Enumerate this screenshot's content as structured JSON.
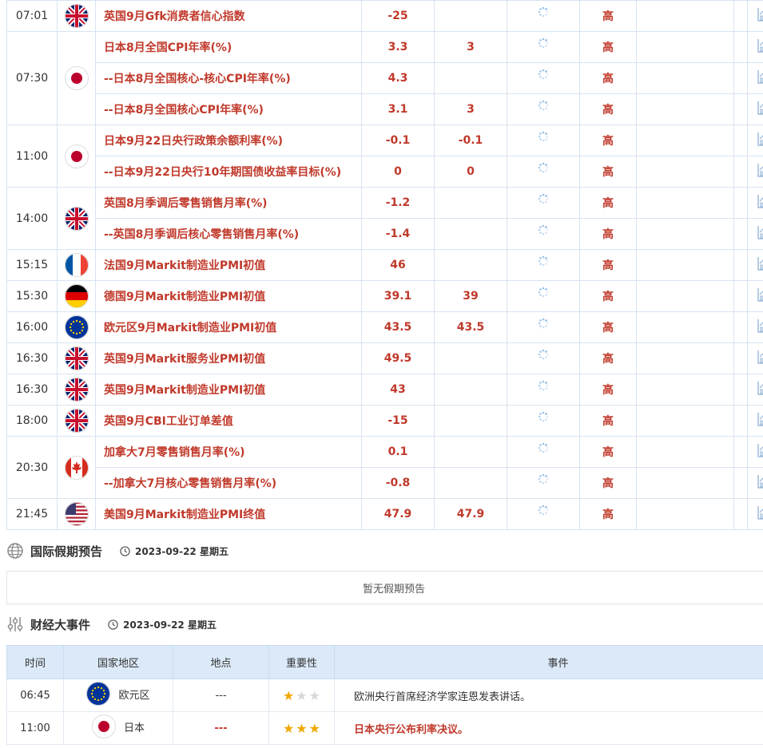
{
  "data_table": {
    "groups": [
      {
        "time": "07:01",
        "flag": "uk-flag-icon",
        "rows": [
          {
            "indicator": "英国9月Gfk消费者信心指数",
            "previous": "-25",
            "forecast": "",
            "importance": "高"
          }
        ]
      },
      {
        "time": "07:30",
        "flag": "japan-flag-icon",
        "rows": [
          {
            "indicator": "日本8月全国CPI年率(%)",
            "previous": "3.3",
            "forecast": "3",
            "importance": "高"
          },
          {
            "indicator": "--日本8月全国核心-核心CPI年率(%)",
            "previous": "4.3",
            "forecast": "",
            "importance": "高"
          },
          {
            "indicator": "--日本8月全国核心CPI年率(%)",
            "previous": "3.1",
            "forecast": "3",
            "importance": "高"
          }
        ]
      },
      {
        "time": "11:00",
        "flag": "japan-flag-icon",
        "rows": [
          {
            "indicator": "日本9月22日央行政策余额利率(%)",
            "previous": "-0.1",
            "forecast": "-0.1",
            "importance": "高"
          },
          {
            "indicator": "--日本9月22日央行10年期国债收益率目标(%)",
            "previous": "0",
            "forecast": "0",
            "importance": "高"
          }
        ]
      },
      {
        "time": "14:00",
        "flag": "uk-flag-icon",
        "rows": [
          {
            "indicator": "英国8月季调后零售销售月率(%)",
            "previous": "-1.2",
            "forecast": "",
            "importance": "高"
          },
          {
            "indicator": "--英国8月季调后核心零售销售月率(%)",
            "previous": "-1.4",
            "forecast": "",
            "importance": "高"
          }
        ]
      },
      {
        "time": "15:15",
        "flag": "france-flag-icon",
        "rows": [
          {
            "indicator": "法国9月Markit制造业PMI初值",
            "previous": "46",
            "forecast": "",
            "importance": "高"
          }
        ]
      },
      {
        "time": "15:30",
        "flag": "germany-flag-icon",
        "rows": [
          {
            "indicator": "德国9月Markit制造业PMI初值",
            "previous": "39.1",
            "forecast": "39",
            "importance": "高"
          }
        ]
      },
      {
        "time": "16:00",
        "flag": "eu-flag-icon",
        "rows": [
          {
            "indicator": "欧元区9月Markit制造业PMI初值",
            "previous": "43.5",
            "forecast": "43.5",
            "importance": "高"
          }
        ]
      },
      {
        "time": "16:30",
        "flag": "uk-flag-icon",
        "rows": [
          {
            "indicator": "英国9月Markit服务业PMI初值",
            "previous": "49.5",
            "forecast": "",
            "importance": "高"
          }
        ]
      },
      {
        "time": "16:30",
        "flag": "uk-flag-icon",
        "rows": [
          {
            "indicator": "英国9月Markit制造业PMI初值",
            "previous": "43",
            "forecast": "",
            "importance": "高"
          }
        ]
      },
      {
        "time": "18:00",
        "flag": "uk-flag-icon",
        "rows": [
          {
            "indicator": "英国9月CBI工业订单差值",
            "previous": "-15",
            "forecast": "",
            "importance": "高"
          }
        ]
      },
      {
        "time": "20:30",
        "flag": "canada-flag-icon",
        "rows": [
          {
            "indicator": "加拿大7月零售销售月率(%)",
            "previous": "0.1",
            "forecast": "",
            "importance": "高"
          },
          {
            "indicator": "--加拿大7月核心零售销售月率(%)",
            "previous": "-0.8",
            "forecast": "",
            "importance": "高"
          }
        ]
      },
      {
        "time": "21:45",
        "flag": "usa-flag-icon",
        "rows": [
          {
            "indicator": "美国9月Markit制造业PMI终值",
            "previous": "47.9",
            "forecast": "47.9",
            "importance": "高"
          }
        ]
      }
    ]
  },
  "holiday": {
    "title": "国际假期预告",
    "date": "2023-09-22 星期五",
    "empty_text": "暂无假期预告",
    "icon": "globe-icon"
  },
  "events": {
    "title": "财经大事件",
    "date": "2023-09-22 星期五",
    "icon": "sliders-icon",
    "headers": [
      "时间",
      "国家地区",
      "地点",
      "重要性",
      "事件"
    ],
    "rows": [
      {
        "time": "06:45",
        "flag": "eu-flag-icon",
        "country": "欧元区",
        "location": "---",
        "stars": 1,
        "event": "欧洲央行首席经济学家连恩发表讲话。",
        "high": false
      },
      {
        "time": "11:00",
        "flag": "japan-flag-icon",
        "country": "日本",
        "location": "---",
        "stars": 3,
        "event": "日本央行公布利率决议。",
        "high": true
      }
    ]
  },
  "colors": {
    "accent_red": "#c0392b",
    "border_blue": "#d7e3f1",
    "header_blue": "#dbe9f8",
    "star_gold": "#f0a800"
  }
}
